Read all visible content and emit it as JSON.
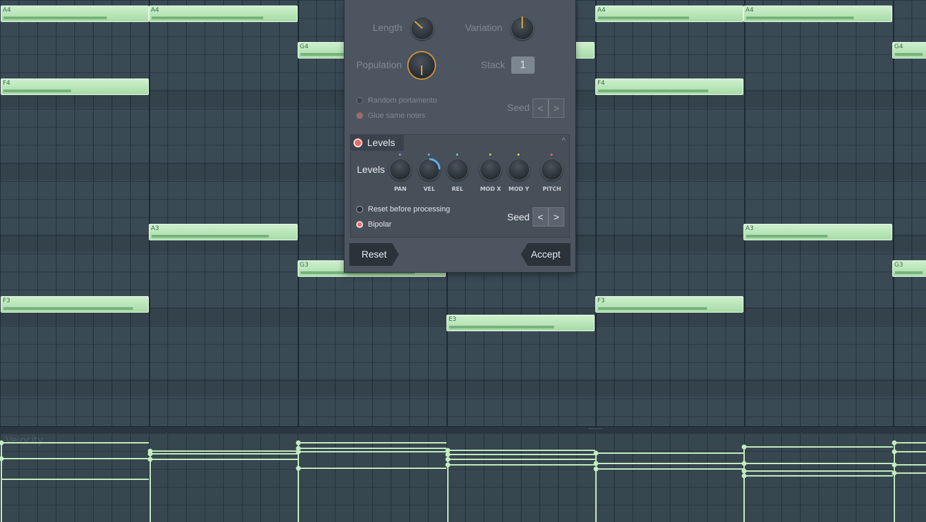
{
  "piano_roll": {
    "notes": [
      {
        "label": "A4"
      },
      {
        "label": "A4"
      },
      {
        "label": "A4"
      },
      {
        "label": "A4"
      },
      {
        "label": "G4"
      },
      {
        "label": ""
      },
      {
        "label": "G4"
      },
      {
        "label": "F4"
      },
      {
        "label": "F4"
      },
      {
        "label": "A3"
      },
      {
        "label": "A3"
      },
      {
        "label": "G3"
      },
      {
        "label": "G3"
      },
      {
        "label": "F3"
      },
      {
        "label": "F3"
      },
      {
        "label": "E3"
      }
    ]
  },
  "velocity_panel": {
    "label": "Velocity"
  },
  "dialog": {
    "length_label": "Length",
    "variation_label": "Variation",
    "population_label": "Population",
    "stack_label": "Stack",
    "stack_value": "1",
    "random_portamento_label": "Random portamento",
    "glue_same_notes_label": "Glue same notes",
    "seed_label_top": "Seed",
    "levels_tab_label": "Levels",
    "levels_row_label": "Levels",
    "knobs": [
      {
        "label": "PAN",
        "dot_color": "#9a8fe0"
      },
      {
        "label": "VEL",
        "dot_color": "#5fb0e6"
      },
      {
        "label": "REL",
        "dot_color": "#74d4c0"
      },
      {
        "label": "MOD X",
        "dot_color": "#a7e06a"
      },
      {
        "label": "MOD Y",
        "dot_color": "#e8d66a"
      },
      {
        "label": "PITCH",
        "dot_color": "#e86a6a"
      }
    ],
    "reset_before_processing_label": "Reset before processing",
    "bipolar_label": "Bipolar",
    "seed_label_bottom": "Seed",
    "prev_arrow": "<",
    "next_arrow": ">",
    "reset_button": "Reset",
    "accept_button": "Accept",
    "collapse_arrow": "^"
  }
}
